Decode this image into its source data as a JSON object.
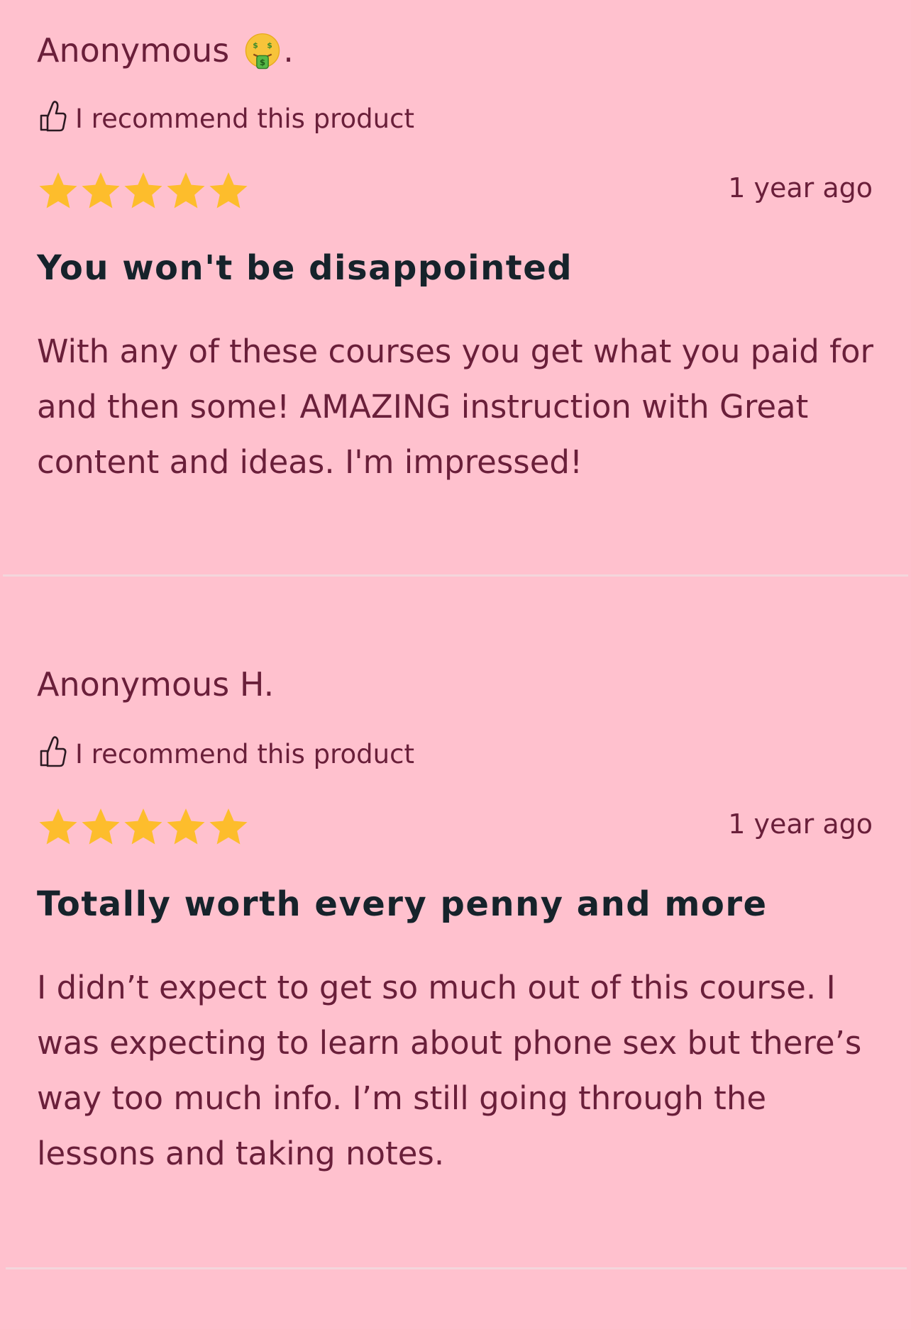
{
  "colors": {
    "background": "#ffc1ce",
    "text": "#6a1f3a",
    "title": "#16232b",
    "star": "#fdbd2c",
    "divider": "#f3d6dc"
  },
  "reviews": [
    {
      "author": "Anonymous",
      "author_suffix": ".",
      "author_emoji": "money-mouth-face-emoji",
      "recommend_icon": "thumbs-up-icon",
      "recommend_label": "I recommend this product",
      "rating": 5,
      "rating_max": 5,
      "date": "1 year ago",
      "title": "You won't be disappointed",
      "body": "With any of these courses you get what you paid for and then some! AMAZING instruction with Great content and ideas. I'm impressed!"
    },
    {
      "author": "Anonymous H.",
      "recommend_icon": "thumbs-up-icon",
      "recommend_label": "I recommend this product",
      "rating": 5,
      "rating_max": 5,
      "date": "1 year ago",
      "title": "Totally worth every penny and more",
      "body": "I didn’t expect to get so much out of this course. I was expecting to learn about phone sex but there’s way too much info. I’m still going through the lessons and taking notes."
    }
  ]
}
